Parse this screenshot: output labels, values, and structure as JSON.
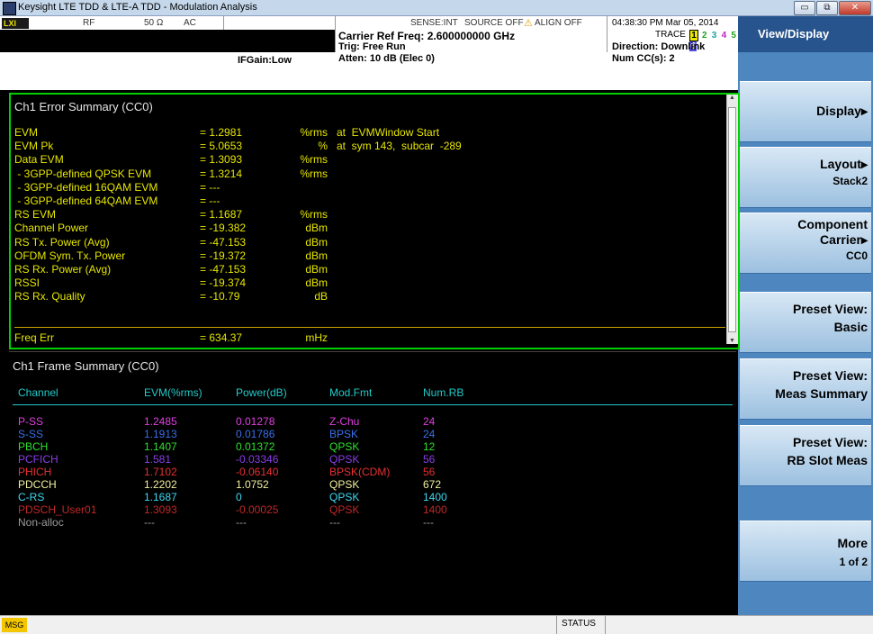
{
  "window": {
    "title": "Keysight LTE TDD & LTE-A TDD - Modulation Analysis",
    "buttons": {
      "minimize": "▭",
      "maximize": "⧉",
      "close": "✕"
    }
  },
  "info": {
    "logo": "LXI",
    "rf": "RF",
    "impedance": "50 Ω",
    "coupling": "AC",
    "sense": "SENSE:INT",
    "source": "SOURCE OFF",
    "align": "ALIGN OFF",
    "datetime": "04:38:30 PM Mar 05, 2014",
    "carrier_ref": "Carrier Ref Freq: 2.600000000 GHz",
    "trig": "Trig: Free Run",
    "atten": "Atten: 10 dB (Elec 0)",
    "if_gain": "IFGain:Low",
    "trace_label": "TRACE",
    "trace_digits": [
      "1",
      "2",
      "3",
      "4",
      "5",
      "6"
    ],
    "direction": "Direction: Downlink",
    "num_cc": "Num CC(s): 2"
  },
  "softkeys": {
    "header": "View/Display",
    "items": [
      {
        "l1": "Display▸",
        "l2": ""
      },
      {
        "l1": "Layout▸",
        "l2": "Stack2"
      },
      {
        "l1": "Component",
        "l1b": "Carrier▸",
        "l2": "CC0"
      },
      {
        "l1": "Preset View:",
        "l2": "Basic"
      },
      {
        "l1": "Preset View:",
        "l2": "Meas Summary"
      },
      {
        "l1": "Preset View:",
        "l2": "RB Slot Meas"
      },
      {
        "l1": "More",
        "l2": "1 of 2"
      }
    ]
  },
  "error_summary": {
    "title": "Ch1 Error Summary (CC0)",
    "rows": [
      {
        "label": "EVM",
        "eq": "= 1.2981",
        "unit": "%rms",
        "extra": "at  EVMWindow Start"
      },
      {
        "label": "EVM Pk",
        "eq": "= 5.0653",
        "unit": "%",
        "extra": "at  sym 143,  subcar  -289"
      },
      {
        "label": "Data EVM",
        "eq": "= 1.3093",
        "unit": "%rms",
        "extra": ""
      },
      {
        "label": " - 3GPP-defined QPSK EVM",
        "eq": "= 1.3214",
        "unit": "%rms",
        "extra": ""
      },
      {
        "label": " - 3GPP-defined 16QAM EVM",
        "eq": "= ---",
        "unit": "",
        "extra": ""
      },
      {
        "label": " - 3GPP-defined 64QAM EVM",
        "eq": "= ---",
        "unit": "",
        "extra": ""
      },
      {
        "label": "RS EVM",
        "eq": "= 1.1687",
        "unit": "%rms",
        "extra": ""
      },
      {
        "label": "Channel Power",
        "eq": "= -19.382",
        "unit": "dBm",
        "extra": ""
      },
      {
        "label": "RS Tx. Power (Avg)",
        "eq": "= -47.153",
        "unit": "dBm",
        "extra": ""
      },
      {
        "label": "OFDM Sym. Tx. Power",
        "eq": "= -19.372",
        "unit": "dBm",
        "extra": ""
      },
      {
        "label": "RS Rx. Power (Avg)",
        "eq": "= -47.153",
        "unit": "dBm",
        "extra": ""
      },
      {
        "label": "RSSI",
        "eq": "= -19.374",
        "unit": "dBm",
        "extra": ""
      },
      {
        "label": "RS Rx. Quality",
        "eq": "= -10.79",
        "unit": "dB",
        "extra": ""
      },
      {
        "label": "Freq Err",
        "eq": "= 634.37",
        "unit": "mHz",
        "extra": ""
      }
    ]
  },
  "frame_summary": {
    "title": "Ch1 Frame Summary (CC0)",
    "headers": [
      "Channel",
      "EVM(%rms)",
      "Power(dB)",
      "Mod.Fmt",
      "Num.RB"
    ],
    "rows": [
      {
        "ch": "P-SS",
        "evm": "1.2485",
        "pwr": "0.01278",
        "mod": "Z-Chu",
        "rb": "24",
        "color": "#e040e0"
      },
      {
        "ch": "S-SS",
        "evm": "1.1913",
        "pwr": "0.01786",
        "mod": "BPSK",
        "rb": "24",
        "color": "#3a6ee8"
      },
      {
        "ch": "PBCH",
        "evm": "1.1407",
        "pwr": "0.01372",
        "mod": "QPSK",
        "rb": "12",
        "color": "#2ee02e"
      },
      {
        "ch": "PCFICH",
        "evm": "1.581",
        "pwr": "-0.03346",
        "mod": "QPSK",
        "rb": "56",
        "color": "#8a3ee8"
      },
      {
        "ch": "PHICH",
        "evm": "1.7102",
        "pwr": "-0.06140",
        "mod": "BPSK(CDM)",
        "rb": "56",
        "color": "#e83030"
      },
      {
        "ch": "PDCCH",
        "evm": "1.2202",
        "pwr": "1.0752",
        "mod": "QPSK",
        "rb": "672",
        "color": "#f0f0a0"
      },
      {
        "ch": "C-RS",
        "evm": "1.1687",
        "pwr": "0",
        "mod": "QPSK",
        "rb": "1400",
        "color": "#40d8f0"
      },
      {
        "ch": "PDSCH_User01",
        "evm": "1.3093",
        "pwr": "-0.00025",
        "mod": "QPSK",
        "rb": "1400",
        "color": "#c02828"
      },
      {
        "ch": "Non-alloc",
        "evm": "---",
        "pwr": "---",
        "mod": "---",
        "rb": "---",
        "color": "#9a9a9a"
      }
    ]
  },
  "statusbar": {
    "msg": "MSG",
    "status": "STATUS"
  }
}
